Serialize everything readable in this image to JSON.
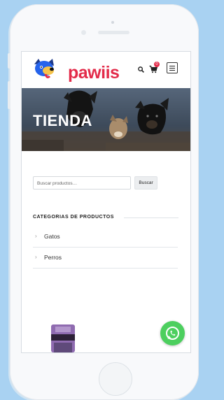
{
  "brand": {
    "name": "pawiis",
    "accent": "#e32b4a"
  },
  "header": {
    "search_icon": "search-icon",
    "cart_icon": "cart-icon",
    "cart_count": "0",
    "menu_icon": "hamburger-menu-icon"
  },
  "hero": {
    "title": "TIENDA"
  },
  "search": {
    "placeholder": "Buscar productos…",
    "button_label": "Buscar"
  },
  "categories": {
    "title": "CATEGORIAS DE PRODUCTOS",
    "items": [
      {
        "label": "Gatos"
      },
      {
        "label": "Perros"
      }
    ]
  },
  "whatsapp": {
    "icon": "whatsapp-icon",
    "color": "#4ccf5e"
  }
}
